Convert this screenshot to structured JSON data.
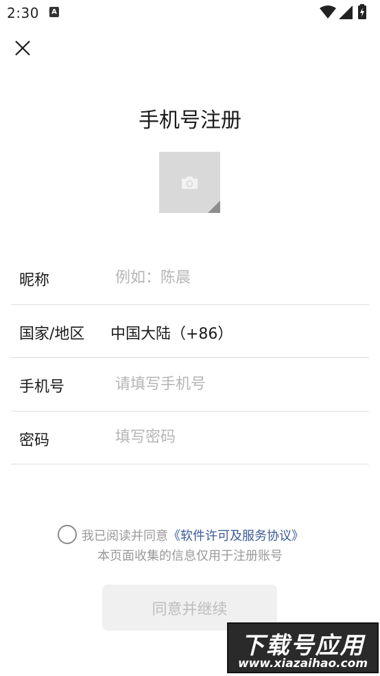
{
  "status_bar": {
    "time": "2:30",
    "notification_icon_letter": "A",
    "icons": [
      "wifi-icon",
      "signal-icon",
      "battery-charging-icon"
    ]
  },
  "header": {
    "close_icon": "close-icon",
    "title": "手机号注册"
  },
  "avatar": {
    "icon": "camera-icon"
  },
  "form": {
    "nickname": {
      "label": "昵称",
      "placeholder": "例如：陈晨",
      "value": ""
    },
    "region": {
      "label": "国家/地区",
      "value": "中国大陆（+86）"
    },
    "phone": {
      "label": "手机号",
      "placeholder": "请填写手机号",
      "value": ""
    },
    "password": {
      "label": "密码",
      "placeholder": "填写密码",
      "value": ""
    }
  },
  "agreement": {
    "checked": false,
    "prefix": "我已阅读并同意",
    "link": "《软件许可及服务协议》",
    "notice": "本页面收集的信息仅用于注册账号"
  },
  "continue_button": {
    "label": "同意并继续",
    "enabled": false
  },
  "watermark": {
    "title": "下载号应用",
    "url": "www.xiazaihao.com"
  },
  "colors": {
    "link": "#3a5a96",
    "placeholder": "#b5b5b5",
    "avatar_bg": "#d9d9d9",
    "button_bg": "#f0f0f0",
    "button_text": "#bdbdbd"
  }
}
